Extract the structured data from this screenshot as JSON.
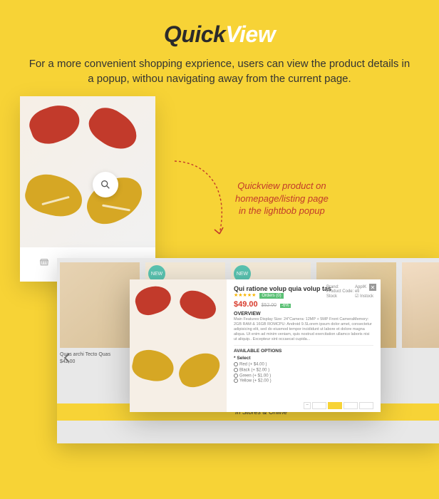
{
  "header": {
    "title_part1": "Quick",
    "title_part2": "View",
    "intro": "For a more convenient shopping exprience, users can view the product details in a popup, withou navigating away from the current page."
  },
  "callout": {
    "line1": "Quickview product on",
    "line2": "homepage/listing page",
    "line3": "in the lightbob popup"
  },
  "strip": {
    "badge_new": "NEW",
    "item_title": "Quas archi Tecto Quas",
    "item_price": "$42,00",
    "banner_text": "In Stores & Online"
  },
  "modal": {
    "title": "Qui ratione volup quia volup tas",
    "stars": "★★★★★",
    "orders_label": "Orders (0)",
    "price_now": "$49.00",
    "price_old": "$52.00",
    "discount": "-6%",
    "specs": {
      "brand_label": "Brand:",
      "brand_value": "AppIK",
      "code_label": "Product Code:",
      "code_value": "eti",
      "stock_label": "Stock",
      "stock_value": "☑ Instock"
    },
    "overview_title": "OVERVIEW",
    "overview_text": "Main Features:Display Size: 24\"Camera: 12MP + 5MP Front CameraMemory: 2GB RAM & 16GB ROMCPU: Android 9.SLorem ipsum dolor amet, consectetur adipisicing elit, sed do eiusmod tempor incididunt ut labore et dolore magna aliqua. Ut enim ad minim veniam, quis nostrud exercitation ullamco laboris nisi ut aliquip.. Excepteur sint occaecat cupida...",
    "avail_title": "AVAILABLE OPTIONS",
    "select_label": "* Select",
    "options": {
      "red": "Red (+ $4.00 )",
      "black": "Black (+ $2.00 )",
      "green": "Green (+ $1.00 )",
      "yellow": "Yellow (+ $2.00 )"
    },
    "qty_minus": "−"
  }
}
